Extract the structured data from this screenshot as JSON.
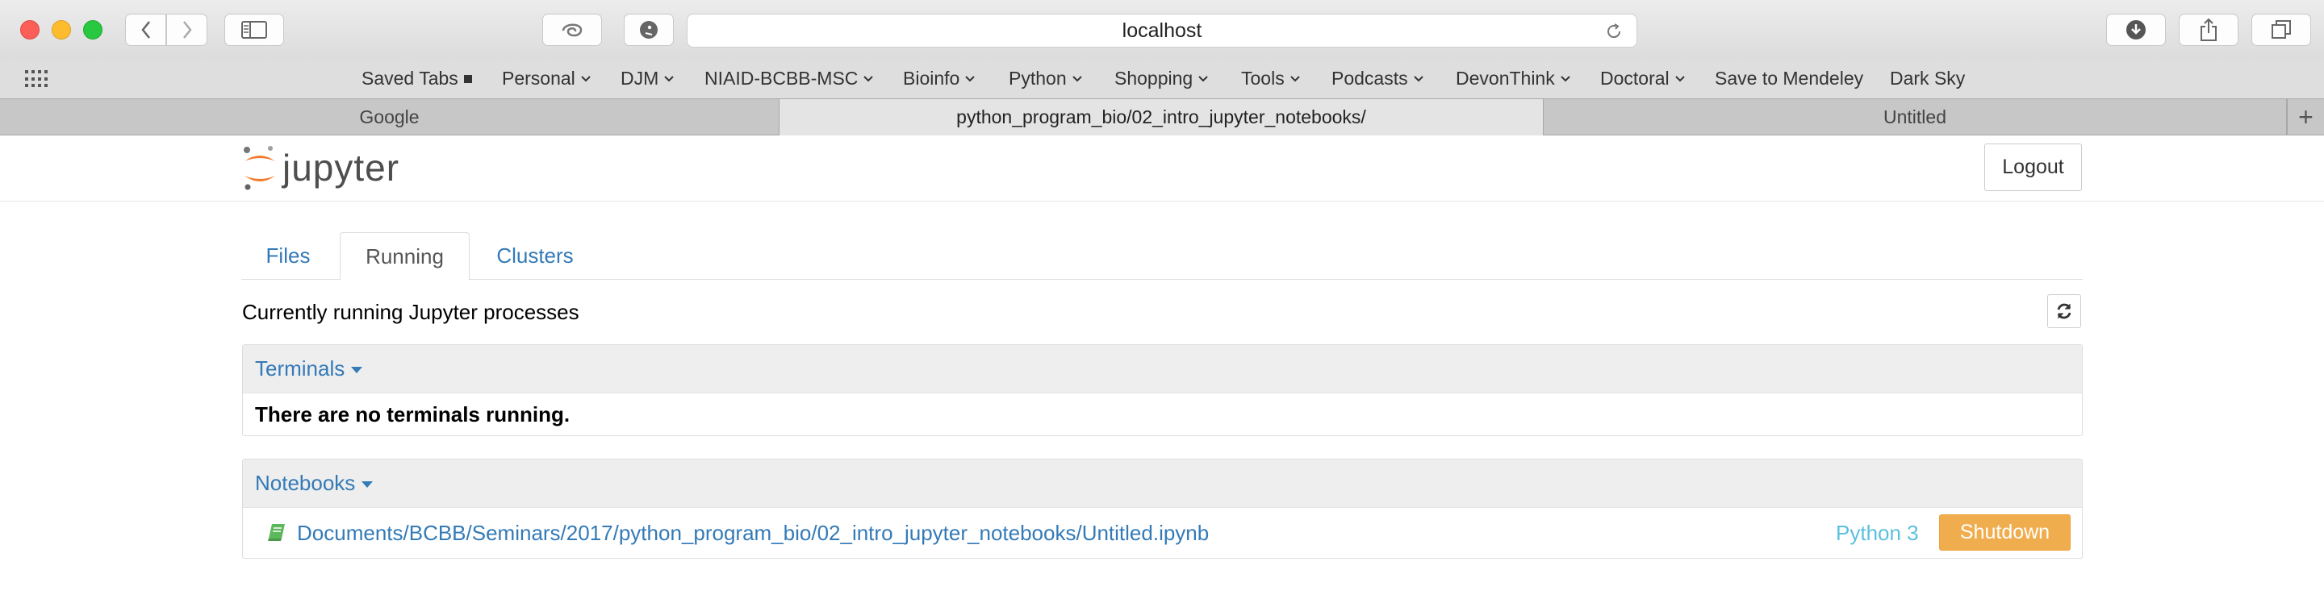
{
  "browser": {
    "url": "localhost",
    "bookmarks": [
      {
        "label": "Saved Tabs",
        "kind": "square"
      },
      {
        "label": "Personal",
        "kind": "menu"
      },
      {
        "label": "DJM",
        "kind": "menu"
      },
      {
        "label": "NIAID-BCBB-MSC",
        "kind": "menu"
      },
      {
        "label": "Bioinfo",
        "kind": "menu"
      },
      {
        "label": "Python",
        "kind": "menu"
      },
      {
        "label": "Shopping",
        "kind": "menu"
      },
      {
        "label": "Tools",
        "kind": "menu"
      },
      {
        "label": "Podcasts",
        "kind": "menu"
      },
      {
        "label": "DevonThink",
        "kind": "menu"
      },
      {
        "label": "Doctoral",
        "kind": "menu"
      },
      {
        "label": "Save to Mendeley",
        "kind": "link"
      },
      {
        "label": "Dark Sky",
        "kind": "link"
      }
    ],
    "tabs": [
      {
        "label": "Google",
        "active": false
      },
      {
        "label": "python_program_bio/02_intro_jupyter_notebooks/",
        "active": true
      },
      {
        "label": "Untitled",
        "active": false
      }
    ],
    "new_tab_label": "+"
  },
  "jupyter": {
    "logo_text": "jupyter",
    "logout_label": "Logout",
    "nav_tabs": [
      "Files",
      "Running",
      "Clusters"
    ],
    "active_tab": "Running",
    "running_title": "Currently running Jupyter processes",
    "terminals": {
      "heading": "Terminals",
      "empty_message": "There are no terminals running."
    },
    "notebooks": {
      "heading": "Notebooks",
      "items": [
        {
          "path": "Documents/BCBB/Seminars/2017/python_program_bio/02_intro_jupyter_notebooks/Untitled.ipynb",
          "kernel": "Python 3",
          "action": "Shutdown"
        }
      ]
    }
  },
  "colors": {
    "link": "#337ab7",
    "kernel": "#5bc0de",
    "shutdown": "#f0ad4e",
    "jupyter_orange": "#f37726"
  }
}
